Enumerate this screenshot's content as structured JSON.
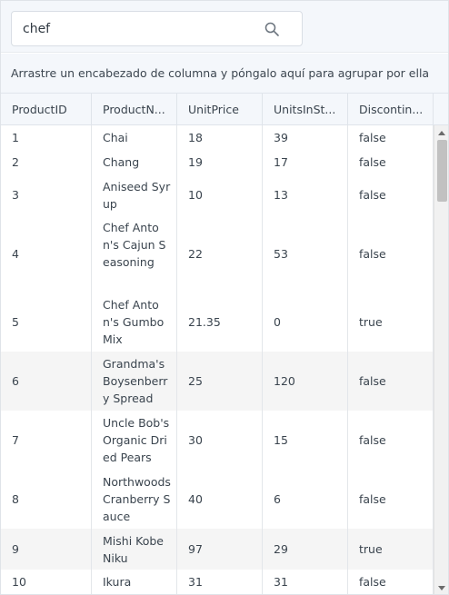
{
  "search": {
    "value": "chef"
  },
  "group_panel": {
    "text": "Arrastre un encabezado de columna y póngalo aquí para agrupar por ella"
  },
  "columns": [
    "ProductID",
    "ProductN...",
    "UnitPrice",
    "UnitsInSt...",
    "Discontin..."
  ],
  "rows": [
    {
      "id": "1",
      "name": "Chai",
      "price": "18",
      "stock": "39",
      "disc": "false"
    },
    {
      "id": "2",
      "name": "Chang",
      "price": "19",
      "stock": "17",
      "disc": "false"
    },
    {
      "id": "3",
      "name": "Aniseed Syrup",
      "price": "10",
      "stock": "13",
      "disc": "false"
    },
    {
      "id": "4",
      "name": "Chef Anton's Cajun Seasoning",
      "price": "22",
      "stock": "53",
      "disc": "false"
    },
    {
      "id": "5",
      "name": "Chef Anton's Gumbo Mix",
      "price": "21.35",
      "stock": "0",
      "disc": "true"
    },
    {
      "id": "6",
      "name": "Grandma's Boysenberry Spread",
      "price": "25",
      "stock": "120",
      "disc": "false"
    },
    {
      "id": "7",
      "name": "Uncle Bob's Organic Dried Pears",
      "price": "30",
      "stock": "15",
      "disc": "false"
    },
    {
      "id": "8",
      "name": "Northwoods Cranberry Sauce",
      "price": "40",
      "stock": "6",
      "disc": "false"
    },
    {
      "id": "9",
      "name": "Mishi Kobe Niku",
      "price": "97",
      "stock": "29",
      "disc": "true"
    },
    {
      "id": "10",
      "name": "Ikura",
      "price": "31",
      "stock": "31",
      "disc": "false"
    }
  ],
  "colors": {
    "panel": "#f4f7fb",
    "border": "#dfe4ea",
    "alt_row": "#f5f5f5"
  }
}
